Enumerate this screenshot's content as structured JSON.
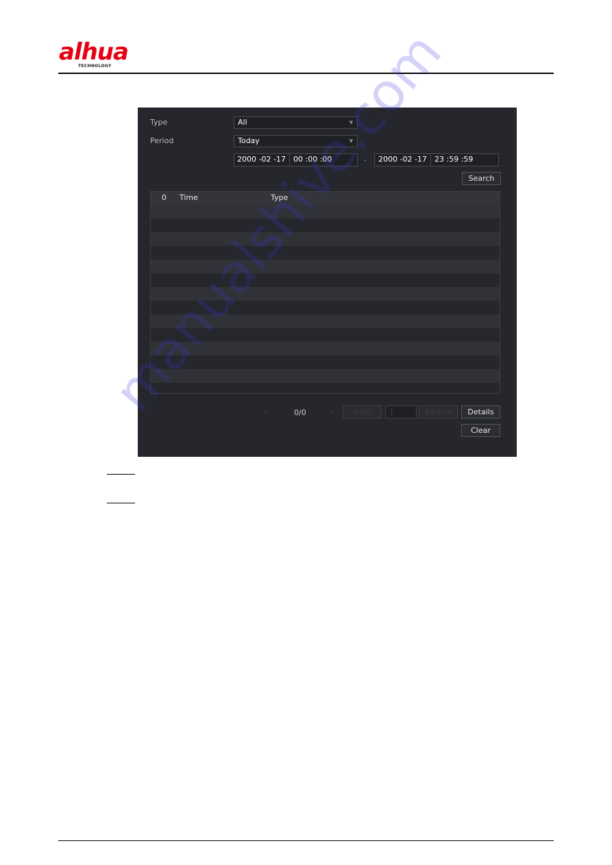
{
  "header": {
    "logo_text": "alhua",
    "logo_subtext": "TECHNOLOGY",
    "brand_color": "#e60012"
  },
  "form": {
    "type_label": "Type",
    "type_value": "All",
    "period_label": "Period",
    "period_value": "Today",
    "start_date": "2000 -02 -17",
    "start_time": "00 :00 :00",
    "range_separator": "-",
    "end_date": "2000 -02 -17",
    "end_time": "23 :59 :59",
    "search_label": "Search"
  },
  "table": {
    "columns": [
      "0",
      "Time",
      "Type"
    ],
    "rows": []
  },
  "pagination": {
    "prev_icon": "‹",
    "page_status": "0/0",
    "next_icon": "›",
    "goto_label": "Goto",
    "page_input_value": "1",
    "backup_label": "Backup",
    "details_label": "Details",
    "clear_label": "Clear"
  },
  "watermark": "manualshive.com"
}
